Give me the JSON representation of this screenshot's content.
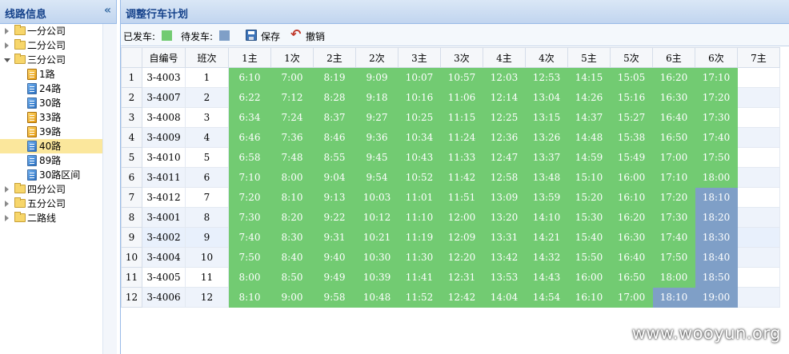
{
  "left_panel": {
    "title": "线路信息",
    "collapse_icon": "«",
    "tree": [
      {
        "label": "一分公司",
        "type": "folder",
        "level": 0,
        "state": "closed"
      },
      {
        "label": "二分公司",
        "type": "folder",
        "level": 0,
        "state": "closed"
      },
      {
        "label": "三分公司",
        "type": "folder",
        "level": 0,
        "state": "open"
      },
      {
        "label": "1路",
        "type": "route",
        "color": "orange",
        "level": 1
      },
      {
        "label": "24路",
        "type": "route",
        "color": "blue",
        "level": 1
      },
      {
        "label": "30路",
        "type": "route",
        "color": "blue",
        "level": 1
      },
      {
        "label": "33路",
        "type": "route",
        "color": "orange",
        "level": 1
      },
      {
        "label": "39路",
        "type": "route",
        "color": "orange",
        "level": 1
      },
      {
        "label": "40路",
        "type": "route",
        "color": "blue",
        "level": 1,
        "selected": true
      },
      {
        "label": "89路",
        "type": "route",
        "color": "blue",
        "level": 1
      },
      {
        "label": "30路区间",
        "type": "route",
        "color": "blue",
        "level": 1
      },
      {
        "label": "四分公司",
        "type": "folder",
        "level": 0,
        "state": "closed"
      },
      {
        "label": "五分公司",
        "type": "folder",
        "level": 0,
        "state": "closed"
      },
      {
        "label": "二路线",
        "type": "folder",
        "level": 0,
        "state": "closed"
      }
    ]
  },
  "right_panel": {
    "title": "调整行车计划",
    "toolbar": {
      "departed_label": "已发车:",
      "pending_label": "待发车:",
      "save_label": "保存",
      "undo_label": "撤销"
    },
    "colors": {
      "departed": "#72cb72",
      "pending": "#7f9fc7",
      "selected_row": "#fbe79c"
    },
    "columns": [
      "",
      "自编号",
      "班次",
      "1主",
      "1次",
      "2主",
      "2次",
      "3主",
      "3次",
      "4主",
      "4次",
      "5主",
      "5次",
      "6主",
      "6次",
      "7主"
    ],
    "rows": [
      {
        "n": "1",
        "id": "3-4003",
        "shift": "1",
        "times": [
          "6:10",
          "7:00",
          "8:19",
          "9:09",
          "10:07",
          "10:57",
          "12:03",
          "12:53",
          "14:15",
          "15:05",
          "16:20",
          "17:10"
        ],
        "pending": []
      },
      {
        "n": "2",
        "id": "3-4007",
        "shift": "2",
        "times": [
          "6:22",
          "7:12",
          "8:28",
          "9:18",
          "10:16",
          "11:06",
          "12:14",
          "13:04",
          "14:26",
          "15:16",
          "16:30",
          "17:20"
        ],
        "pending": []
      },
      {
        "n": "3",
        "id": "3-4008",
        "shift": "3",
        "times": [
          "6:34",
          "7:24",
          "8:37",
          "9:27",
          "10:25",
          "11:15",
          "12:25",
          "13:15",
          "14:37",
          "15:27",
          "16:40",
          "17:30"
        ],
        "pending": []
      },
      {
        "n": "4",
        "id": "3-4009",
        "shift": "4",
        "times": [
          "6:46",
          "7:36",
          "8:46",
          "9:36",
          "10:34",
          "11:24",
          "12:36",
          "13:26",
          "14:48",
          "15:38",
          "16:50",
          "17:40"
        ],
        "pending": []
      },
      {
        "n": "5",
        "id": "3-4010",
        "shift": "5",
        "times": [
          "6:58",
          "7:48",
          "8:55",
          "9:45",
          "10:43",
          "11:33",
          "12:47",
          "13:37",
          "14:59",
          "15:49",
          "17:00",
          "17:50"
        ],
        "pending": []
      },
      {
        "n": "6",
        "id": "3-4011",
        "shift": "6",
        "times": [
          "7:10",
          "8:00",
          "9:04",
          "9:54",
          "10:52",
          "11:42",
          "12:58",
          "13:48",
          "15:10",
          "16:00",
          "17:10",
          "18:00"
        ],
        "pending": []
      },
      {
        "n": "7",
        "id": "3-4012",
        "shift": "7",
        "times": [
          "7:20",
          "8:10",
          "9:13",
          "10:03",
          "11:01",
          "11:51",
          "13:09",
          "13:59",
          "15:20",
          "16:10",
          "17:20",
          "18:10"
        ],
        "pending": [
          11
        ]
      },
      {
        "n": "8",
        "id": "3-4001",
        "shift": "8",
        "times": [
          "7:30",
          "8:20",
          "9:22",
          "10:12",
          "11:10",
          "12:00",
          "13:20",
          "14:10",
          "15:30",
          "16:20",
          "17:30",
          "18:20"
        ],
        "pending": [
          11
        ]
      },
      {
        "n": "9",
        "id": "3-4002",
        "shift": "9",
        "times": [
          "7:40",
          "8:30",
          "9:31",
          "10:21",
          "11:19",
          "12:09",
          "13:31",
          "14:21",
          "15:40",
          "16:30",
          "17:40",
          "18:30"
        ],
        "pending": [
          11
        ]
      },
      {
        "n": "10",
        "id": "3-4004",
        "shift": "10",
        "times": [
          "7:50",
          "8:40",
          "9:40",
          "10:30",
          "11:30",
          "12:20",
          "13:42",
          "14:32",
          "15:50",
          "16:40",
          "17:50",
          "18:40"
        ],
        "pending": [
          11
        ]
      },
      {
        "n": "11",
        "id": "3-4005",
        "shift": "11",
        "times": [
          "8:00",
          "8:50",
          "9:49",
          "10:39",
          "11:41",
          "12:31",
          "13:53",
          "14:43",
          "16:00",
          "16:50",
          "18:00",
          "18:50"
        ],
        "pending": [
          11
        ]
      },
      {
        "n": "12",
        "id": "3-4006",
        "shift": "12",
        "times": [
          "8:10",
          "9:00",
          "9:58",
          "10:48",
          "11:52",
          "12:42",
          "14:04",
          "14:54",
          "16:10",
          "17:00",
          "18:10",
          "19:00"
        ],
        "pending": [
          10,
          11
        ]
      }
    ],
    "highlighted_row": 9
  },
  "watermark": "www.wooyun.org"
}
